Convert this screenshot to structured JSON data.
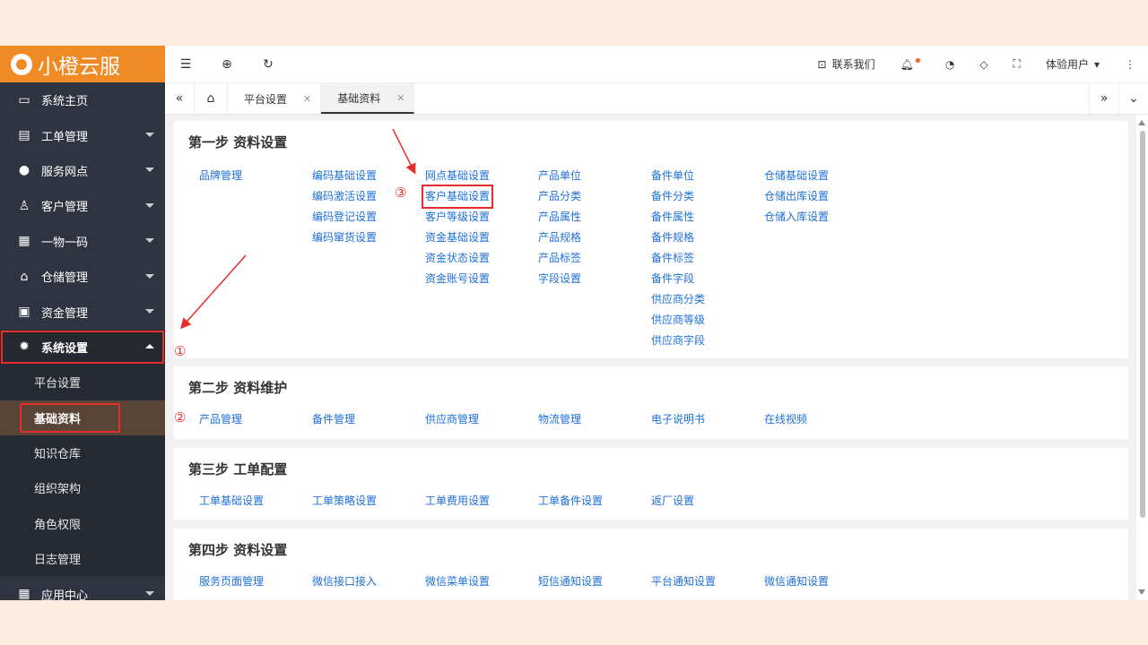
{
  "brand": {
    "name": "小橙云服"
  },
  "sidebar": {
    "items": [
      {
        "label": "系统主页",
        "icon": "monitor-icon"
      },
      {
        "label": "工单管理",
        "icon": "document-icon"
      },
      {
        "label": "服务网点",
        "icon": "globe-icon"
      },
      {
        "label": "客户管理",
        "icon": "user-icon"
      },
      {
        "label": "一物一码",
        "icon": "grid-icon"
      },
      {
        "label": "仓储管理",
        "icon": "bank-icon"
      },
      {
        "label": "资金管理",
        "icon": "money-icon"
      },
      {
        "label": "系统设置",
        "icon": "gear-icon"
      }
    ],
    "sub_items": [
      "平台设置",
      "基础资料",
      "知识仓库",
      "组织架构",
      "角色权限",
      "日志管理"
    ],
    "after": {
      "label": "应用中心",
      "icon": "grid-icon"
    }
  },
  "topbar": {
    "contact": "联系我们",
    "user": "体验用户"
  },
  "tabs": [
    {
      "label": "平台设置"
    },
    {
      "label": "基础资料"
    }
  ],
  "sections": [
    {
      "title": "第一步 资料设置",
      "columns": [
        [
          "品牌管理"
        ],
        [
          "编码基础设置",
          "编码激活设置",
          "编码登记设置",
          "编码窜货设置"
        ],
        [
          "网点基础设置",
          "客户基础设置",
          "客户等级设置",
          "资金基础设置",
          "资金状态设置",
          "资金账号设置"
        ],
        [
          "产品单位",
          "产品分类",
          "产品属性",
          "产品规格",
          "产品标签",
          "字段设置"
        ],
        [
          "备件单位",
          "备件分类",
          "备件属性",
          "备件规格",
          "备件标签",
          "备件字段",
          "供应商分类",
          "供应商等级",
          "供应商字段"
        ],
        [
          "仓储基础设置",
          "仓储出库设置",
          "仓储入库设置"
        ]
      ]
    },
    {
      "title": "第二步 资料维护",
      "columns": [
        [
          "产品管理"
        ],
        [
          "备件管理"
        ],
        [
          "供应商管理"
        ],
        [
          "物流管理"
        ],
        [
          "电子说明书"
        ],
        [
          "在线视频"
        ]
      ]
    },
    {
      "title": "第三步 工单配置",
      "columns": [
        [
          "工单基础设置"
        ],
        [
          "工单策略设置"
        ],
        [
          "工单费用设置"
        ],
        [
          "工单备件设置"
        ],
        [
          "返厂设置"
        ]
      ]
    },
    {
      "title": "第四步 资料设置",
      "columns": [
        [
          "服务页面管理"
        ],
        [
          "微信接口接入"
        ],
        [
          "微信菜单设置"
        ],
        [
          "短信通知设置"
        ],
        [
          "平台通知设置"
        ],
        [
          "微信通知设置"
        ]
      ]
    }
  ],
  "annotations": {
    "step1": "①",
    "step2": "②",
    "step3": "③"
  }
}
